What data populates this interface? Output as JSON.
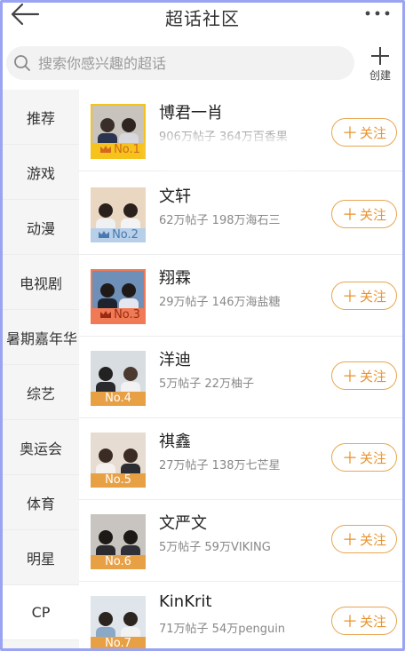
{
  "header": {
    "title": "超话社区"
  },
  "search": {
    "placeholder": "搜索你感兴趣的超话",
    "value": ""
  },
  "create": {
    "label": "创建"
  },
  "sidebar": {
    "items": [
      {
        "label": "推荐"
      },
      {
        "label": "游戏"
      },
      {
        "label": "动漫"
      },
      {
        "label": "电视剧"
      },
      {
        "label": "暑期嘉年华"
      },
      {
        "label": "综艺"
      },
      {
        "label": "奥运会"
      },
      {
        "label": "体育"
      },
      {
        "label": "明星"
      },
      {
        "label": "CP"
      }
    ],
    "active": "CP"
  },
  "list": {
    "follow_label": "关注",
    "rows": [
      {
        "name": "博君一肖",
        "stats": "906万帖子 364万百香果",
        "rank": "No.1",
        "badge_color": "#f6c21c"
      },
      {
        "name": "文轩",
        "stats": "62万帖子 198万海石三",
        "rank": "No.2",
        "badge_color": "#a9c6e4"
      },
      {
        "name": "翔霖",
        "stats": "29万帖子 146万海盐糖",
        "rank": "No.3",
        "badge_color": "#ef7a55"
      },
      {
        "name": "洋迪",
        "stats": "5万帖子 22万柚子",
        "rank": "No.4",
        "badge_color": "#e8a045"
      },
      {
        "name": "祺鑫",
        "stats": "27万帖子 138万七芒星",
        "rank": "No.5",
        "badge_color": "#e8a045"
      },
      {
        "name": "文严文",
        "stats": "5万帖子 59万VIKING",
        "rank": "No.6",
        "badge_color": "#e8a045"
      },
      {
        "name": "KinKrit",
        "stats": "71万帖子 54万penguin",
        "rank": "No.7",
        "badge_color": "#e8a045"
      }
    ]
  },
  "colors": {
    "accent": "#e8932e",
    "sidebar_bg": "#f5f5f5",
    "frame": "#9aa4f2"
  }
}
